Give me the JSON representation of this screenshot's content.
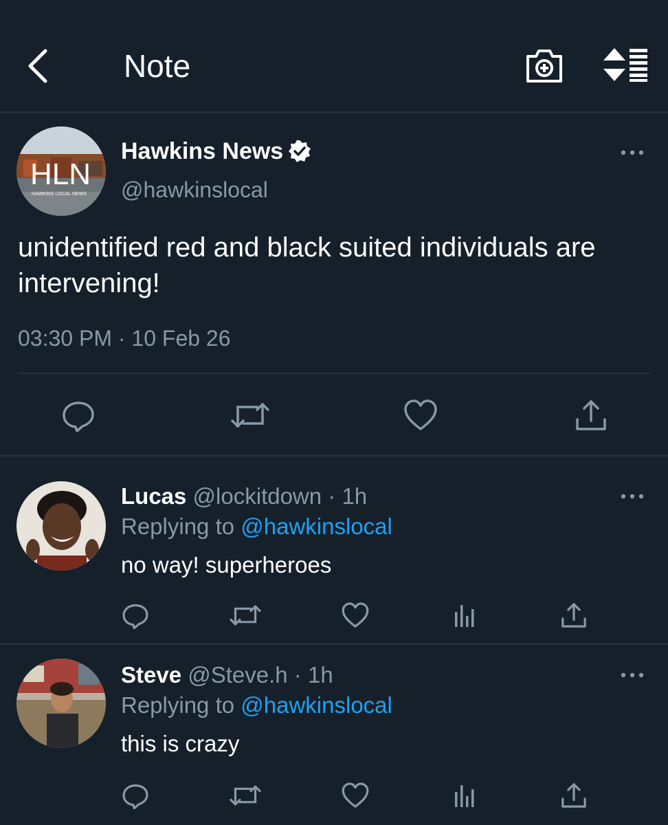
{
  "header": {
    "title": "Note",
    "back_icon": "chevron-left-icon",
    "camera_icon": "camera-plus-icon",
    "sort_icon": "sort-list-icon"
  },
  "main_tweet": {
    "avatar_text": "HLN",
    "avatar_subtext": "HAWKINS LOCAL NEWS",
    "name": "Hawkins News",
    "handle": "@hawkinslocal",
    "text": "unidentified red and black suited individuals are intervening!",
    "time": "03:30 PM · 10 Feb 26",
    "actions": [
      "reply-icon",
      "retweet-icon",
      "like-icon",
      "share-icon"
    ]
  },
  "replies": [
    {
      "name": "Lucas",
      "meta": "@lockitdown · 1h",
      "replying_prefix": "Replying to ",
      "replying_handle": "@hawkinslocal",
      "text": "no way! superheroes"
    },
    {
      "name": "Steve",
      "meta": "@Steve.h · 1h",
      "replying_prefix": "Replying to ",
      "replying_handle": "@hawkinslocal",
      "text": "this is crazy"
    }
  ],
  "colors": {
    "background": "#15202b",
    "divider": "#253341",
    "secondary_text": "#8899a6",
    "link": "#1da1f2"
  }
}
